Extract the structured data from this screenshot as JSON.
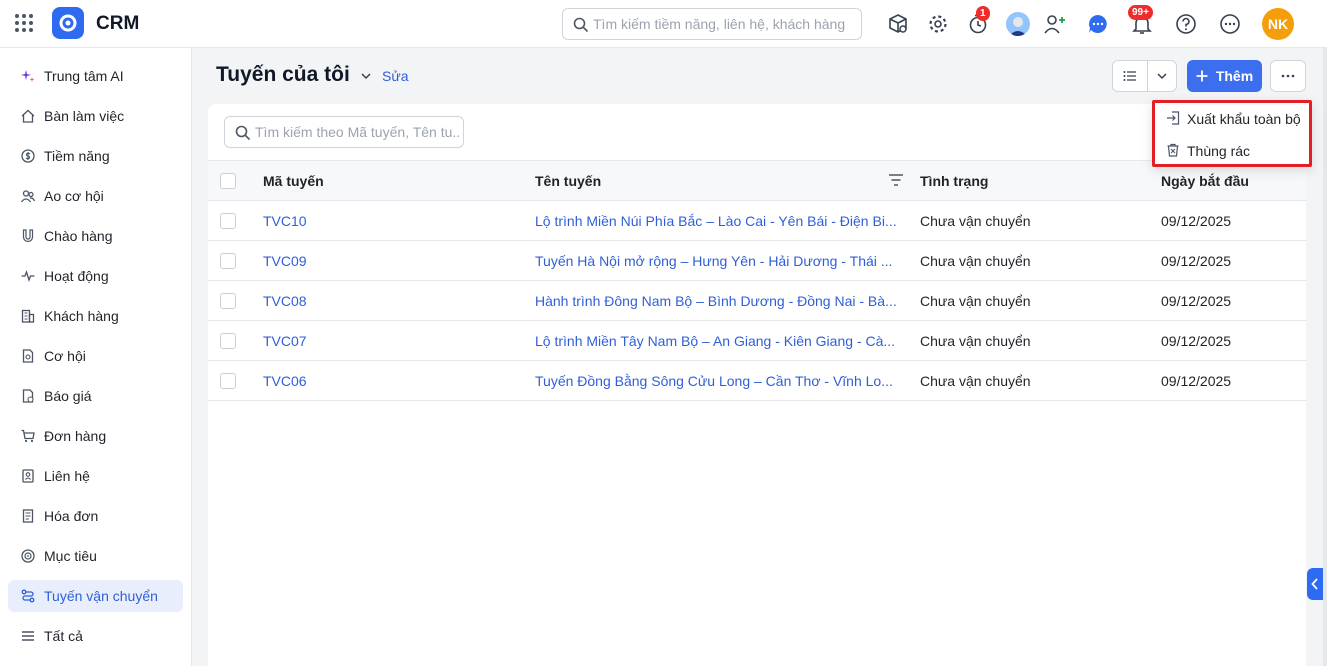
{
  "app": {
    "brand": "CRM"
  },
  "header": {
    "search_placeholder": "Tìm kiếm tiềm năng, liên hệ, khách hàng",
    "timer_badge": "1",
    "notification_badge": "99+",
    "user_initials": "NK",
    "icons": [
      "package-search-icon",
      "gear-icon",
      "timer-icon",
      "user-avatar",
      "add-user-icon",
      "chat-icon",
      "bell-icon",
      "help-icon",
      "more-icon"
    ]
  },
  "sidebar": {
    "items": [
      {
        "label": "Trung tâm AI",
        "icon": "sparkle-icon"
      },
      {
        "label": "Bàn làm việc",
        "icon": "home-icon"
      },
      {
        "label": "Tiềm năng",
        "icon": "dollar-circle-icon"
      },
      {
        "label": "Ao cơ hội",
        "icon": "group-icon"
      },
      {
        "label": "Chào hàng",
        "icon": "magnet-icon"
      },
      {
        "label": "Hoạt động",
        "icon": "pulse-icon"
      },
      {
        "label": "Khách hàng",
        "icon": "building-icon"
      },
      {
        "label": "Cơ hội",
        "icon": "file-icon"
      },
      {
        "label": "Báo giá",
        "icon": "quote-file-icon"
      },
      {
        "label": "Đơn hàng",
        "icon": "cart-icon"
      },
      {
        "label": "Liên hệ",
        "icon": "contact-icon"
      },
      {
        "label": "Hóa đơn",
        "icon": "invoice-icon"
      },
      {
        "label": "Mục tiêu",
        "icon": "target-icon"
      },
      {
        "label": "Tuyến vận chuyển",
        "icon": "route-icon",
        "active": true
      },
      {
        "label": "Tất cả",
        "icon": "menu-icon"
      }
    ]
  },
  "page": {
    "title": "Tuyến của tôi",
    "edit_label": "Sửa",
    "add_label": "Thêm",
    "accent_color": "#3b6ff0"
  },
  "table": {
    "search_placeholder": "Tìm kiếm theo Mã tuyến, Tên tu...",
    "columns": [
      "Mã tuyến",
      "Tên tuyến",
      "Tình trạng",
      "Ngày bắt đầu"
    ],
    "rows": [
      {
        "code": "TVC10",
        "name": "Lộ trình Miền Núi Phía Bắc – Lào Cai - Yên Bái - Điện Bi...",
        "status": "Chưa vận chuyển",
        "start": "09/12/2025"
      },
      {
        "code": "TVC09",
        "name": "Tuyến Hà Nội mở rộng – Hưng Yên - Hải Dương - Thái ...",
        "status": "Chưa vận chuyển",
        "start": "09/12/2025"
      },
      {
        "code": "TVC08",
        "name": "Hành trình Đông Nam Bộ – Bình Dương - Đồng Nai - Bà...",
        "status": "Chưa vận chuyển",
        "start": "09/12/2025"
      },
      {
        "code": "TVC07",
        "name": "Lộ trình Miền Tây Nam Bộ – An Giang - Kiên Giang - Cà...",
        "status": "Chưa vận chuyển",
        "start": "09/12/2025"
      },
      {
        "code": "TVC06",
        "name": "Tuyến Đồng Bằng Sông Cửu Long – Cần Thơ - Vĩnh Lo...",
        "status": "Chưa vận chuyển",
        "start": "09/12/2025"
      }
    ]
  },
  "dropdown": {
    "items": [
      {
        "label": "Xuất khẩu toàn bộ",
        "icon": "export-icon"
      },
      {
        "label": "Thùng rác",
        "icon": "trash-icon"
      }
    ]
  }
}
